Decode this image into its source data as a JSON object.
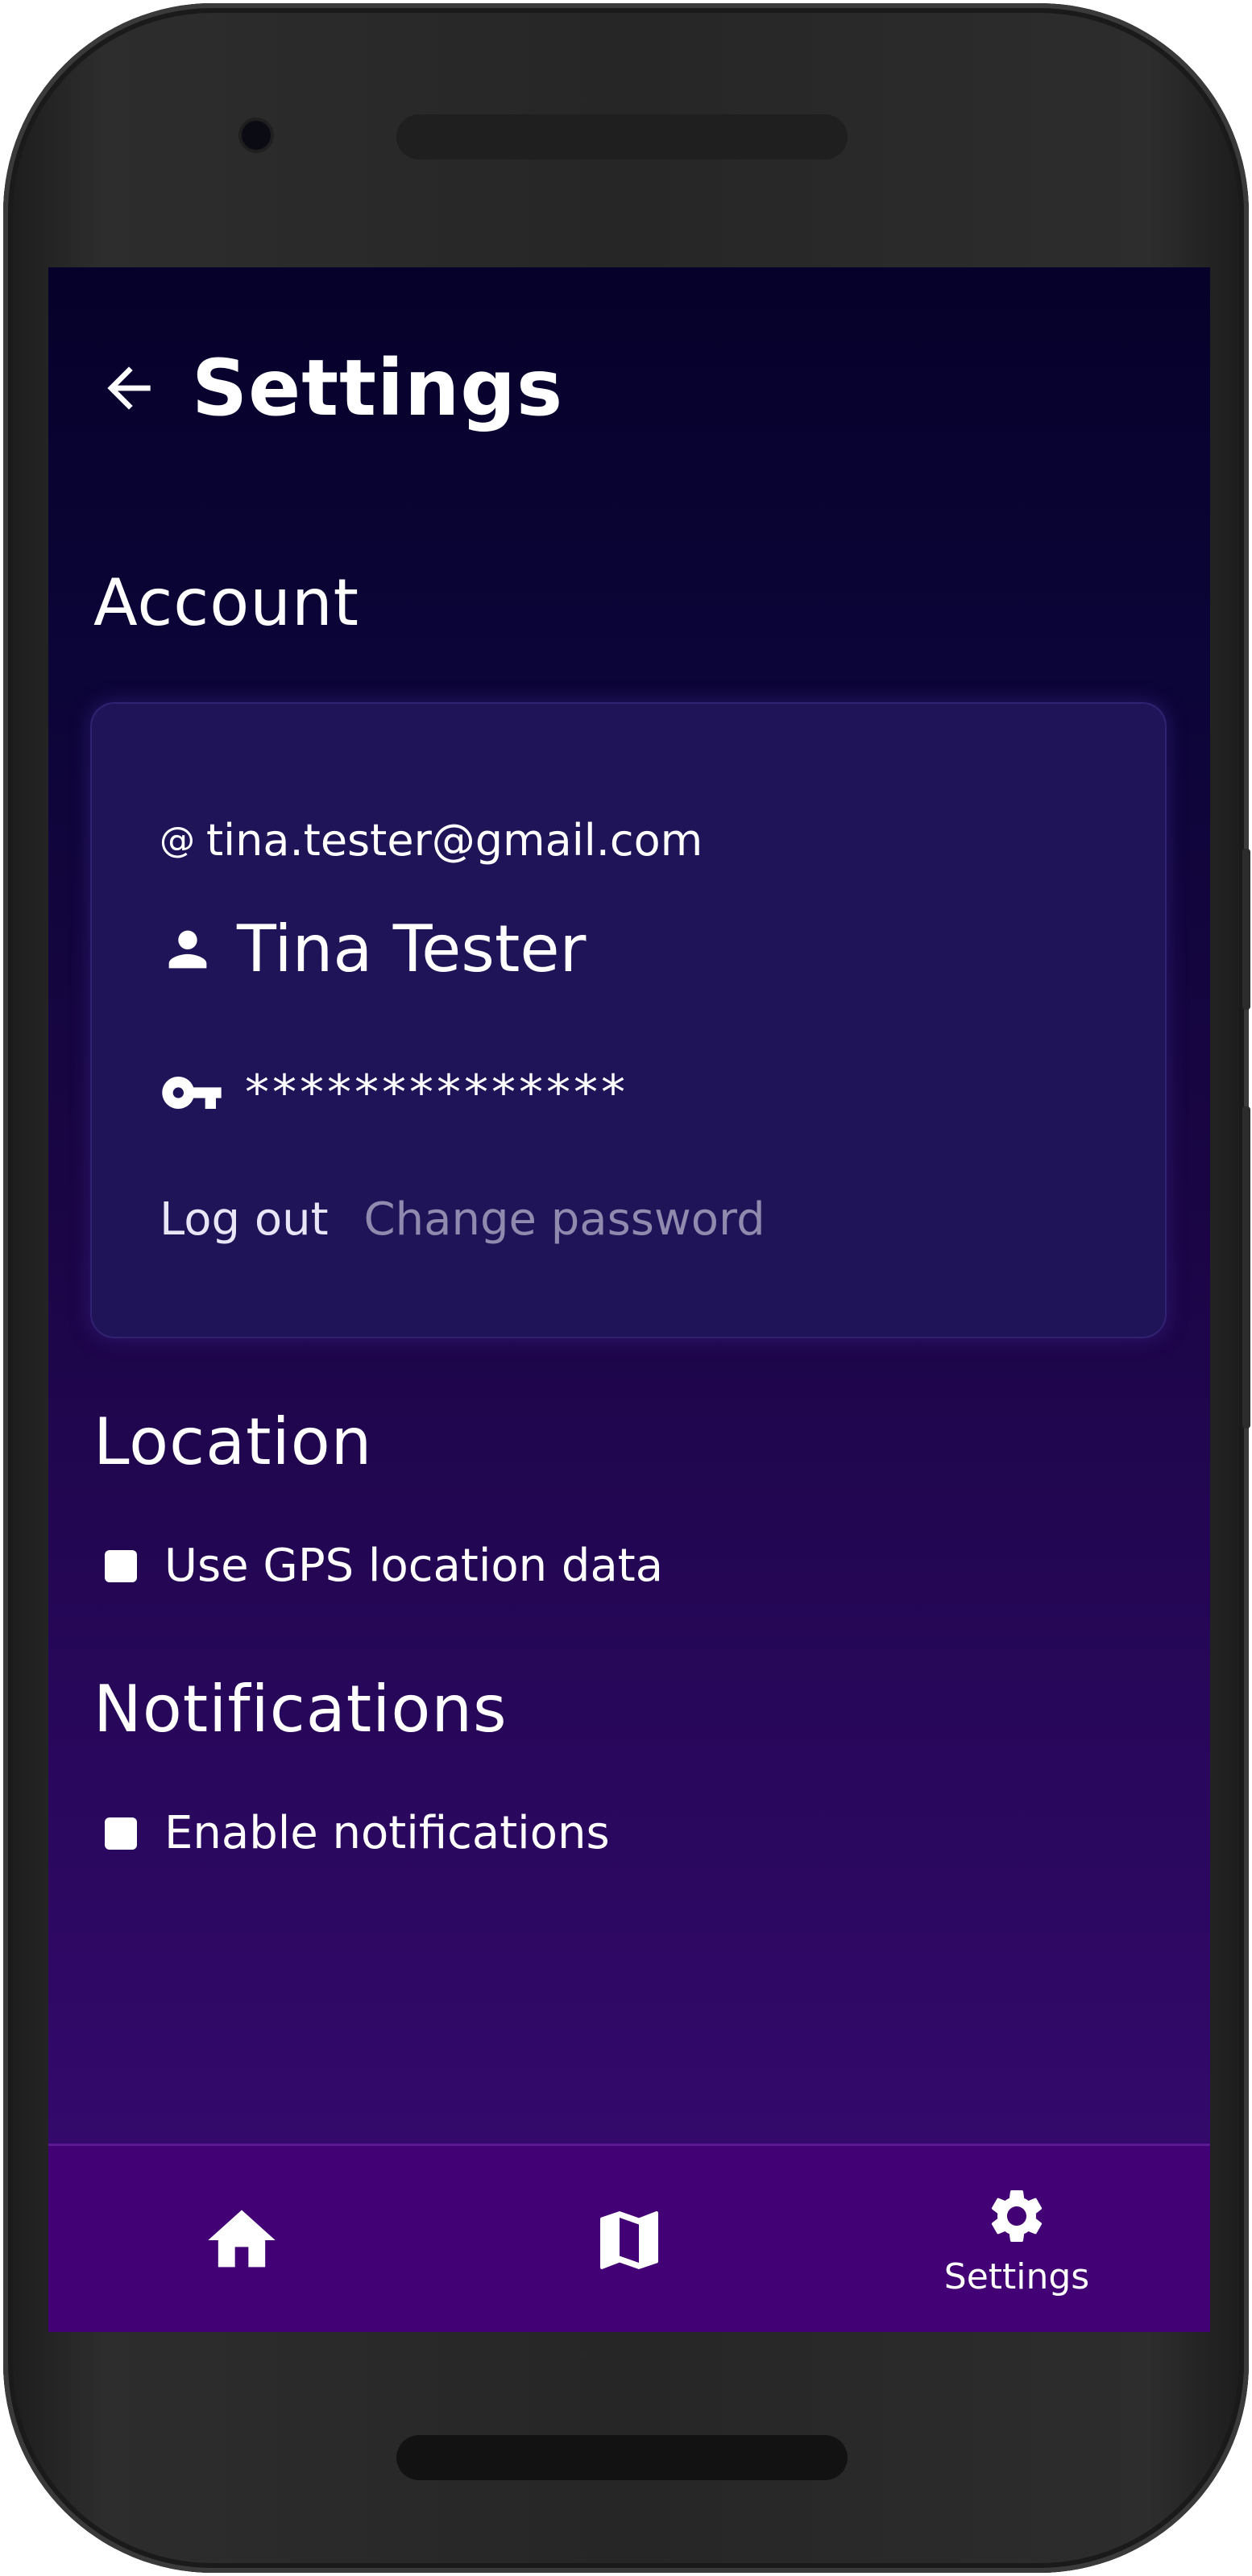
{
  "header": {
    "title": "Settings"
  },
  "account": {
    "section_title": "Account",
    "email_prefix": "@",
    "email": "tina.tester@gmail.com",
    "name": "Tina Tester",
    "password_mask": "**************",
    "logout_label": "Log out",
    "change_password_label": "Change password"
  },
  "location": {
    "section_title": "Location",
    "gps_label": "Use GPS location data",
    "gps_checked": false
  },
  "notifications": {
    "section_title": "Notifications",
    "enable_label": "Enable notifications",
    "enable_checked": false
  },
  "bottom_nav": {
    "items": [
      {
        "icon": "home-icon",
        "label": ""
      },
      {
        "icon": "map-icon",
        "label": ""
      },
      {
        "icon": "gear-icon",
        "label": "Settings"
      }
    ]
  },
  "colors": {
    "background_top": "#05012a",
    "background_bottom": "#34096c",
    "card": "#201458",
    "nav": "#420175",
    "muted_text": "#8f8aae"
  }
}
